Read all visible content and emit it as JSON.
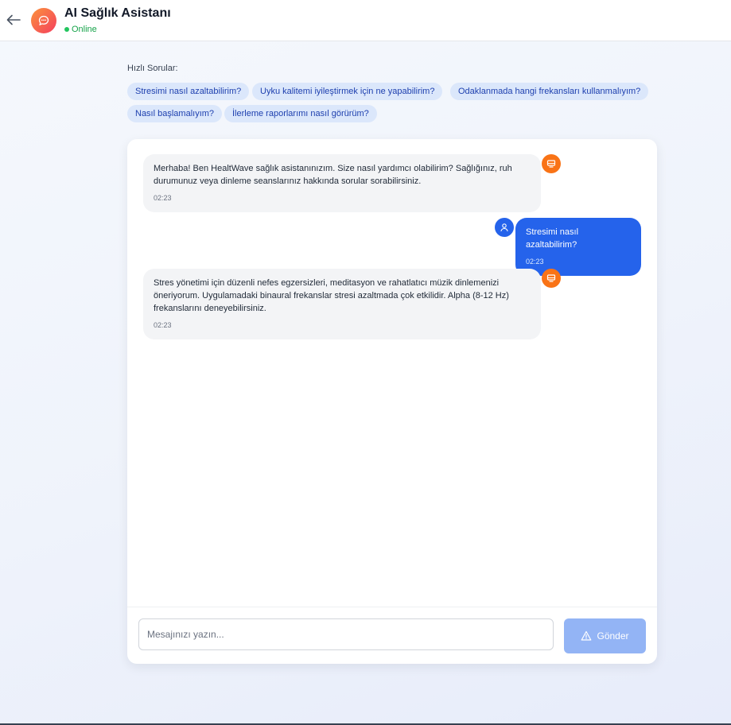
{
  "header": {
    "title": "AI Sağlık Asistanı",
    "status": "Online",
    "back_icon": "arrow-left-icon",
    "app_icon": "chat-bubble-icon"
  },
  "quick_questions": {
    "label": "Hızlı Sorular:",
    "items": [
      "Stresimi nasıl azaltabilirim?",
      "Uyku kalitemi iyileştirmek için ne yapabilirim?",
      "Odaklanmada hangi frekansları kullanmalıyım?",
      "Nasıl başlamalıyım?",
      "İlerleme raporlarımı nasıl görürüm?"
    ]
  },
  "messages": [
    {
      "sender": "bot",
      "text": "Merhaba! Ben HealtWave sağlık asistanınızım. Size nasıl yardımcı olabilirim? Sağlığınız, ruh durumunuz veya dinleme seanslarınız hakkında sorular sorabilirsiniz.",
      "time": "02:23",
      "icon": "bot-icon"
    },
    {
      "sender": "user",
      "text": "Stresimi nasıl azaltabilirim?",
      "time": "02:23",
      "icon": "user-icon"
    },
    {
      "sender": "bot",
      "text": "Stres yönetimi için düzenli nefes egzersizleri, meditasyon ve rahatlatıcı müzik dinlemenizi öneriyorum. Uygulamadaki binaural frekanslar stresi azaltmada çok etkilidir. Alpha (8-12 Hz) frekanslarını deneyebilirsiniz.",
      "time": "02:23",
      "icon": "bot-icon"
    }
  ],
  "composer": {
    "placeholder": "Mesajınızı yazın...",
    "value": "",
    "send_label": "Gönder",
    "send_icon": "send-icon"
  },
  "colors": {
    "accent": "#2563eb",
    "bot_avatar": "#f97316",
    "online": "#22c55e",
    "send_disabled": "#93b4f5",
    "chip_bg": "#dbe7fb"
  }
}
